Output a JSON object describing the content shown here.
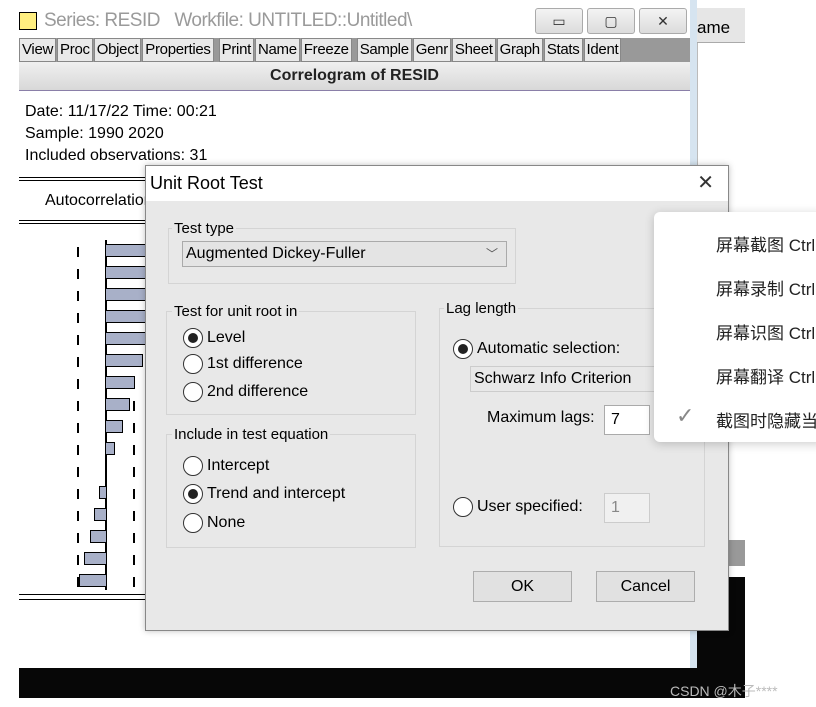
{
  "background_window": {
    "header_fragment": "ame"
  },
  "main_window": {
    "title": "Series: RESID   Workfile: UNTITLED::Untitled\\",
    "controls": {
      "minimize": "▭",
      "maximize": "▢",
      "close": "✕"
    },
    "toolbar": [
      "View",
      "Proc",
      "Object",
      "Properties",
      "Print",
      "Name",
      "Freeze",
      "Sample",
      "Genr",
      "Sheet",
      "Graph",
      "Stats",
      "Ident"
    ],
    "view_title": "Correlogram of RESID",
    "date_line": "Date: 11/17/22   Time: 00:21",
    "sample_line": "Sample: 1990 2020",
    "obs_line": "Included observations: 31",
    "column_header": "Autocorrelation"
  },
  "dialog": {
    "title": "Unit Root Test",
    "close": "✕",
    "test_type": {
      "label": "Test type",
      "value": "Augmented Dickey-Fuller"
    },
    "unit_root_in": {
      "label": "Test for unit root in",
      "options": [
        "Level",
        "1st difference",
        "2nd difference"
      ],
      "selected": "Level"
    },
    "include": {
      "label": "Include in test equation",
      "options": [
        "Intercept",
        "Trend and intercept",
        "None"
      ],
      "selected": "Trend and intercept"
    },
    "lag_length": {
      "label": "Lag length",
      "automatic_label": "Automatic selection:",
      "criterion": "Schwarz Info Criterion",
      "max_lags_label": "Maximum lags:",
      "max_lags": "7",
      "user_label": "User specified:",
      "user_value": "1",
      "selected": "automatic"
    },
    "ok": "OK",
    "cancel": "Cancel"
  },
  "context_menu": {
    "items": [
      {
        "label": "屏幕截图 Ctrl",
        "checked": false
      },
      {
        "label": "屏幕录制 Ctrl",
        "checked": false
      },
      {
        "label": "屏幕识图 Ctrl",
        "checked": false
      },
      {
        "label": "屏幕翻译 Ctrl",
        "checked": false
      },
      {
        "label": "截图时隐藏当",
        "checked": true
      }
    ]
  },
  "watermark": "CSDN @木子****"
}
